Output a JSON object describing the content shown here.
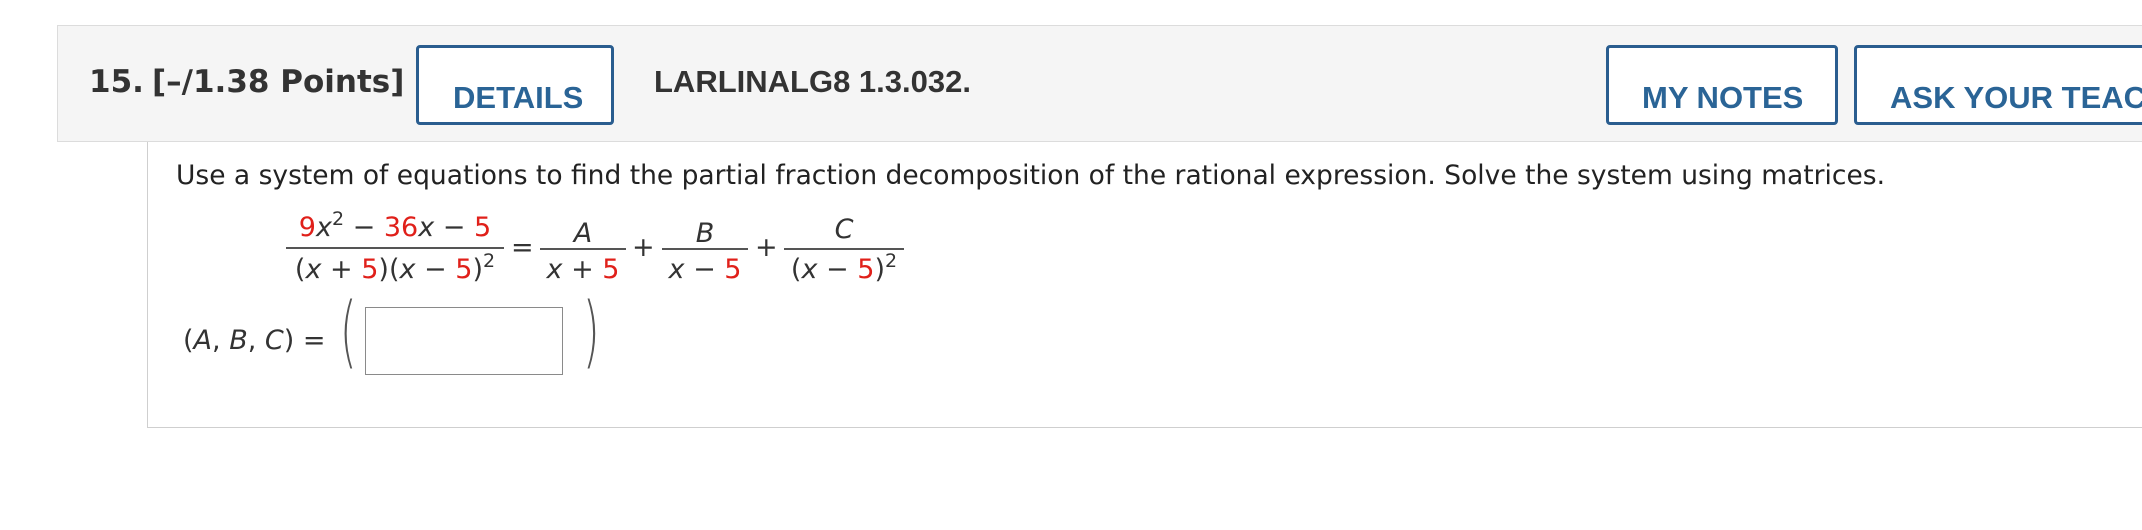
{
  "header": {
    "question_number": "15.",
    "points": "[–/1.38 Points]",
    "details_label": "DETAILS",
    "problem_id": "LARLINALG8 1.3.032.",
    "my_notes_label": "MY NOTES",
    "ask_teacher_label": "ASK YOUR TEACHER"
  },
  "question": {
    "instructions": "Use a system of equations to find the partial fraction decomposition of the rational expression. Solve the system using matrices.",
    "equation": {
      "lhs_num": {
        "a": "9",
        "b": "x",
        "exp": "2",
        "minus1": " − ",
        "c": "36",
        "d": "x",
        "minus2": " − ",
        "e": "5"
      },
      "lhs_den": {
        "p1": "(",
        "x1": "x",
        "plus": " + ",
        "n1": "5",
        "p2": ")(",
        "x2": "x",
        "minus": " − ",
        "n2": "5",
        "p3": ")",
        "exp": "2"
      },
      "equals": "=",
      "term1": {
        "num": "A",
        "den_x": "x",
        "den_op": " + ",
        "den_n": "5"
      },
      "plus1": "+",
      "term2": {
        "num": "B",
        "den_x": "x",
        "den_op": " − ",
        "den_n": "5"
      },
      "plus2": "+",
      "term3": {
        "num": "C",
        "den_open": "(",
        "den_x": "x",
        "den_op": " − ",
        "den_n": "5",
        "den_close": ")",
        "exp": "2"
      }
    },
    "answer_label": {
      "open": "(",
      "a": "A",
      "s1": ", ",
      "b": "B",
      "s2": ", ",
      "c": "C",
      "close": ") =",
      "lparen": "(",
      "rparen": ")"
    },
    "answer_value": ""
  },
  "colors": {
    "accent_blue": "#2a5d8f",
    "highlight_red": "#e0201a"
  }
}
